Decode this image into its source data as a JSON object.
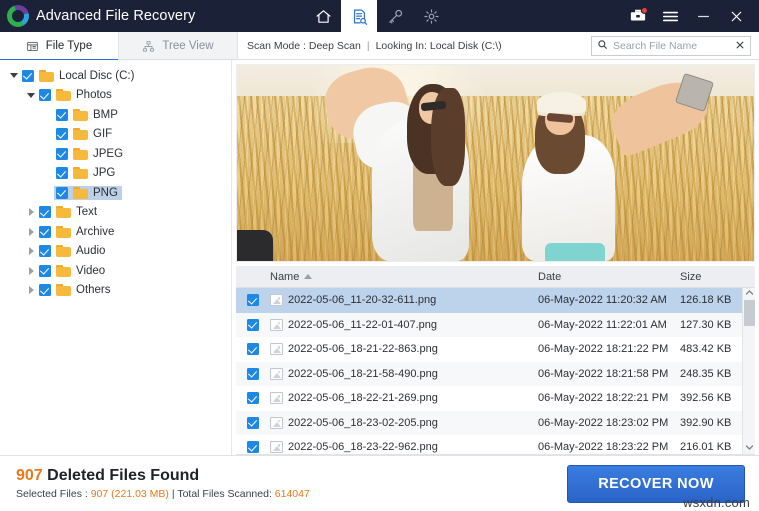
{
  "titlebar": {
    "app_title": "Advanced File Recovery",
    "logo_icon": "app-logo-icon",
    "nav": [
      {
        "icon": "home-icon",
        "name": "home",
        "active": false
      },
      {
        "icon": "scan-document-search-icon",
        "name": "scan",
        "active": true
      },
      {
        "icon": "key-icon",
        "name": "license-key",
        "active": false
      },
      {
        "icon": "gear-icon",
        "name": "settings",
        "active": false
      }
    ],
    "right": [
      {
        "icon": "toolbox-icon",
        "name": "tools",
        "badge": true
      },
      {
        "icon": "hamburger-menu-icon",
        "name": "menu",
        "badge": false
      },
      {
        "icon": "minimize-icon",
        "name": "minimize",
        "badge": false
      },
      {
        "icon": "close-icon",
        "name": "close",
        "badge": false
      }
    ]
  },
  "toolbar": {
    "tabs": [
      {
        "label": "File Type",
        "icon": "file-type-icon",
        "active": true
      },
      {
        "label": "Tree View",
        "icon": "tree-view-icon",
        "active": false
      }
    ],
    "scan_mode_label": "Scan Mode : Deep Scan",
    "separator": "|",
    "looking_in_label": "Looking In: Local Disk (C:\\)",
    "search": {
      "icon": "search-icon",
      "placeholder": "Search File Name",
      "value": "",
      "clear_icon": "close-icon"
    }
  },
  "tree": {
    "nodes": [
      {
        "label": "Local Disc (C:)",
        "depth": 0,
        "twist": "down",
        "checked": true,
        "selected": false
      },
      {
        "label": "Photos",
        "depth": 1,
        "twist": "down",
        "checked": true,
        "selected": false
      },
      {
        "label": "BMP",
        "depth": 2,
        "twist": "none",
        "checked": true,
        "selected": false
      },
      {
        "label": "GIF",
        "depth": 2,
        "twist": "none",
        "checked": true,
        "selected": false
      },
      {
        "label": "JPEG",
        "depth": 2,
        "twist": "none",
        "checked": true,
        "selected": false
      },
      {
        "label": "JPG",
        "depth": 2,
        "twist": "none",
        "checked": true,
        "selected": false
      },
      {
        "label": "PNG",
        "depth": 2,
        "twist": "none",
        "checked": true,
        "selected": true
      },
      {
        "label": "Text",
        "depth": 1,
        "twist": "right",
        "checked": true,
        "selected": false
      },
      {
        "label": "Archive",
        "depth": 1,
        "twist": "right",
        "checked": true,
        "selected": false
      },
      {
        "label": "Audio",
        "depth": 1,
        "twist": "right",
        "checked": true,
        "selected": false
      },
      {
        "label": "Video",
        "depth": 1,
        "twist": "right",
        "checked": true,
        "selected": false
      },
      {
        "label": "Others",
        "depth": 1,
        "twist": "right",
        "checked": true,
        "selected": false
      }
    ]
  },
  "preview": {
    "alt": "Two women taking a selfie in a golden wheat field"
  },
  "list": {
    "columns": {
      "name": "Name",
      "date": "Date",
      "size": "Size"
    },
    "sort": {
      "column": "Name",
      "direction": "asc",
      "icon": "sort-asc-icon"
    },
    "rows": [
      {
        "name": "2022-05-06_11-20-32-611.png",
        "date": "06-May-2022 11:20:32 AM",
        "size": "126.18 KB",
        "checked": true,
        "selected": true
      },
      {
        "name": "2022-05-06_11-22-01-407.png",
        "date": "06-May-2022 11:22:01 AM",
        "size": "127.30 KB",
        "checked": true,
        "selected": false
      },
      {
        "name": "2022-05-06_18-21-22-863.png",
        "date": "06-May-2022 18:21:22 PM",
        "size": "483.42 KB",
        "checked": true,
        "selected": false
      },
      {
        "name": "2022-05-06_18-21-58-490.png",
        "date": "06-May-2022 18:21:58 PM",
        "size": "248.35 KB",
        "checked": true,
        "selected": false
      },
      {
        "name": "2022-05-06_18-22-21-269.png",
        "date": "06-May-2022 18:22:21 PM",
        "size": "392.56 KB",
        "checked": true,
        "selected": false
      },
      {
        "name": "2022-05-06_18-23-02-205.png",
        "date": "06-May-2022 18:23:02 PM",
        "size": "392.90 KB",
        "checked": true,
        "selected": false
      },
      {
        "name": "2022-05-06_18-23-22-962.png",
        "date": "06-May-2022 18:23:22 PM",
        "size": "216.01 KB",
        "checked": true,
        "selected": false
      }
    ],
    "scrollbar": {
      "up_icon": "chevron-up-icon",
      "down_icon": "chevron-down-icon"
    }
  },
  "footer": {
    "found_count": "907",
    "found_label": "Deleted Files Found",
    "selected_prefix": "Selected Files : ",
    "selected_count": "907",
    "selected_size": "(221.03 MB)",
    "stats_separator": " | ",
    "scanned_label": "Total Files Scanned: ",
    "scanned_count": "614047",
    "recover_button": "RECOVER NOW"
  },
  "watermark": {
    "text": "wsxdn.com"
  },
  "colors": {
    "titlebar_bg": "#1b2238",
    "accent_blue": "#2f6fd0",
    "checkbox_blue": "#1e88e5",
    "orange": "#e8791c",
    "selection_blue": "#bdd3ec",
    "button_blue": "#3a7de0",
    "folder_yellow": "#f6b93b"
  }
}
